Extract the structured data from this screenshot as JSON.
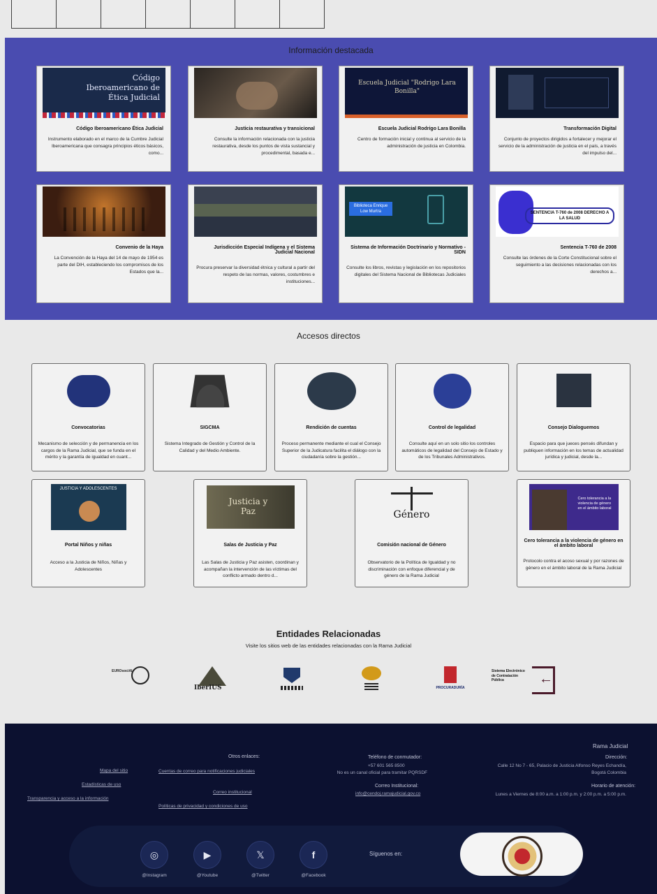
{
  "featured": {
    "title": "Información destacada",
    "cards": [
      {
        "title": "Código Iberoamericano Ética Judicial",
        "desc": "Instrumento elaborado en el marco de la Cumbre Judicial Iberoamericana que consagra principios éticos básicos, como...",
        "thumb_text": "Código Iberoamericano de Ética Judicial"
      },
      {
        "title": "Justicia restaurativa y transicional",
        "desc": "Consulte la información relacionada con la justicia restaurativa, desde los puntos de vista sustancial y procedimental, basada e...",
        "thumb_text": ""
      },
      {
        "title": "Escuela Judicial Rodrigo Lara Bonilla",
        "desc": "Centro de formación inicial y continua al servicio de la administración de justicia en Colombia.",
        "thumb_text": "Escuela Judicial \"Rodrigo Lara Bonilla\""
      },
      {
        "title": "Transformación Digital",
        "desc": "Conjunto de proyectos dirigidos a fortalecer y mejorar el servicio de la administración de justicia en el país, a través del impulso del...",
        "thumb_text": ""
      },
      {
        "title": "Convenio de la Haya",
        "desc": "La Convención de la Haya del 14 de mayo de 1954 es parte del DIH, estableciendo los compromisos de los Estados que la...",
        "thumb_text": ""
      },
      {
        "title": "Jurisdicción Especial Indígena y el Sistema Judicial Nacional",
        "desc": "Procura preservar la diversidad étnica y cultural a partir del respeto de las normas, valores, costumbres e instituciones...",
        "thumb_text": ""
      },
      {
        "title": "Sistema de Información Doctrinario y Normativo - SIDN",
        "desc": "Consulte los libros, revistas y legislación en los repositorios digitales del Sistema Nacional de Bibliotecas Judiciales",
        "thumb_text": "Biblioteca Enrique Low Murtra"
      },
      {
        "title": "Sentencia T-760 de 2008",
        "desc": "Consulte las órdenes de la Corte Constitucional sobre el seguimiento a las decisiones relacionadas con los derechos a...",
        "thumb_text": "SENTENCIA T-760 de 2008 DERECHO A LA SALUD"
      }
    ]
  },
  "accesos": {
    "title": "Accesos directos",
    "row1": [
      {
        "title": "Convocatorias",
        "desc": "Mecanismo de selección y de permanencia en los cargos de la Rama Judicial, que se funda en el mérito y la garantía de igualdad en cuant..."
      },
      {
        "title": "SIGCMA",
        "desc": "Sistema Integrado de Gestión y Control de la Calidad y del Medio Ambiente."
      },
      {
        "title": "Rendición de cuentas",
        "desc": "Proceso permanente mediante el cual el Consejo Superior de la Judicatura facilita el diálogo con la ciudadanía sobre la gestión..."
      },
      {
        "title": "Control de legalidad",
        "desc": "Consulte aquí en un solo sitio los controles automáticos de legalidad del Consejo de Estado y de los Tribunales Administrativos."
      },
      {
        "title": "Consejo Dialoguemos",
        "desc": "Espacio para que jueces pensés difundan y publiquen información en los temas de actualidad jurídica y judicial, desde la..."
      }
    ],
    "row2": [
      {
        "title": "Portal Niños y niñas",
        "desc": "Acceso a la Justicia de Niños, Niñas y Adolescentes",
        "img_text": "JUSTICIA Y ADOLESCENTES"
      },
      {
        "title": "Salas de Justicia y Paz",
        "desc": "Las Salas de Justicia y Paz asisten, coordinan y acompañan la intervención de las víctimas del conflicto armado dentro d...",
        "img_text": "Justicia y Paz"
      },
      {
        "title": "Comisión nacional de Género",
        "desc": "Observatorio de la Política de Igualdad y no discriminación con enfoque diferencial y de género de la Rama Judicial",
        "img_text": "Género"
      },
      {
        "title": "Cero tolerancia a la violencia de género en el ámbito laboral",
        "desc": "Protocolo contra el acoso sexual y por razones de género en el ámbito laboral de la Rama Judicial",
        "img_text": "Cero tolerancia a la violencia de género en el ámbito laboral"
      }
    ]
  },
  "entidades": {
    "title": "Entidades Relacionadas",
    "subtitle": "Visite los sitios web de las entidades relacionadas con la Rama Judicial",
    "logos": [
      {
        "name": "EUROsociAL",
        "icon": "eurosocial-logo"
      },
      {
        "name": "IberIUS",
        "icon": "iberius-logo"
      },
      {
        "name": "",
        "icon": "shield-logo"
      },
      {
        "name": "",
        "icon": "eye-logo"
      },
      {
        "name": "PROCURADURÍA",
        "icon": "procuraduria-logo"
      },
      {
        "name": "Sistema Electrónico de Contratación Pública",
        "icon": "secop-logo"
      }
    ]
  },
  "footer": {
    "org": "Rama Judicial",
    "dir_label": "Dirección:",
    "dir_value": "Calle 12 No 7 - 65, Palacio de Justicia Alfonso Reyes Echandía, Bogotá Colombia",
    "hours_label": "Horario de atención:",
    "hours_value": "Lunes a Viernes de 8:00 a.m. a 1:00 p.m. y 2:00 p.m. a 5:00 p.m.",
    "phone_label": "Teléfono de conmutador:",
    "phone_value": "+57 601 565 8500",
    "phone_note": "No es un canal oficial para tramitar PQRSDF",
    "email_label": "Correo Institucional:",
    "email_value": "info@cendoj.ramajudicial.gov.co",
    "other_label": "Otros enlaces:",
    "links_mid": [
      "Cuentas de correo para notificaciones judiciales",
      "Correo institucional",
      "Políticas de privacidad y condiciones de uso"
    ],
    "links_right": [
      "Mapa del sitio",
      "Estadísticas de uso",
      "Transparencia y acceso a la información"
    ],
    "follow": "Síguenos en:",
    "social": [
      {
        "label": "@Instagram",
        "icon": "instagram-icon",
        "glyph": "◎"
      },
      {
        "label": "@Youtube",
        "icon": "youtube-icon",
        "glyph": "▶"
      },
      {
        "label": "@Twitter",
        "icon": "x-icon",
        "glyph": "𝕏"
      },
      {
        "label": "@Facebook",
        "icon": "facebook-icon",
        "glyph": "f"
      }
    ]
  }
}
